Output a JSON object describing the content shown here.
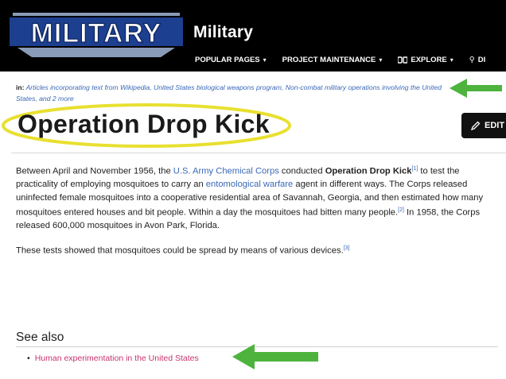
{
  "header": {
    "logo_text": "MILITARY",
    "site_title": "Military",
    "nav": [
      {
        "label": "POPULAR PAGES",
        "caret": "▾"
      },
      {
        "label": "PROJECT MAINTENANCE",
        "caret": "▾"
      },
      {
        "label": "EXPLORE",
        "caret": "▾"
      },
      {
        "label": "DI",
        "caret": ""
      }
    ]
  },
  "categories": {
    "prefix": "in:",
    "links": [
      "Articles incorporating text from Wikipedia,",
      "United States biological weapons program,",
      "Non-combat military operations involving the United States,",
      "and 2 more"
    ]
  },
  "page": {
    "title": "Operation Drop Kick",
    "edit_label": "EDIT"
  },
  "article": {
    "p1": {
      "t1": "Between April and November 1956, the ",
      "link1": "U.S. Army Chemical Corps",
      "t2": " conducted ",
      "bold": "Operation Drop Kick",
      "ref1": "[1]",
      "t3": " to test the practicality of employing mosquitoes to carry an ",
      "link2": "entomological warfare",
      "t4": " agent in different ways. The Corps released uninfected female mosquitoes into a cooperative residential area of Savannah, Georgia, and then estimated how many mosquitoes entered houses and bit people. Within a day the mosquitoes had bitten many people.",
      "ref2": "[2]",
      "t5": " In 1958, the Corps released 600,000 mosquitoes in Avon Park, Florida."
    },
    "p2": {
      "text": "These tests showed that mosquitoes could be spread by means of various devices.",
      "ref3": "[3]"
    }
  },
  "see_also": {
    "heading": "See also",
    "items": [
      "Human experimentation in the United States"
    ]
  },
  "colors": {
    "header_bg": "#000000",
    "link": "#3a68b7",
    "redlink": "#c8336e",
    "annotation_arrow": "#4db33d",
    "annotation_ellipse": "#e8e030"
  },
  "icons": [
    "military-logo",
    "explore-icon",
    "pencil-icon",
    "arrow-annotation-icon",
    "ellipse-annotation"
  ]
}
